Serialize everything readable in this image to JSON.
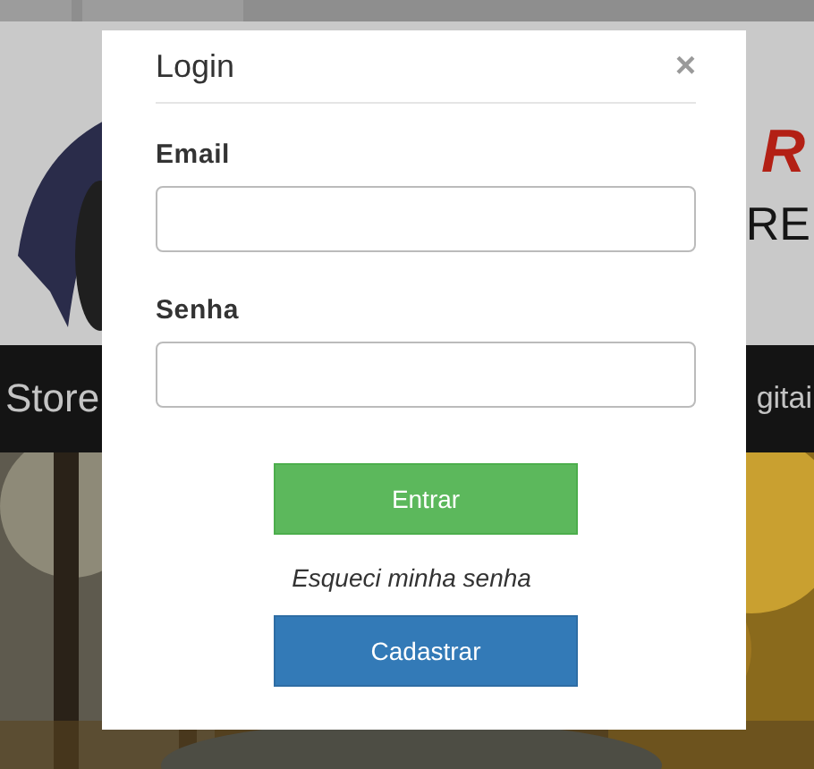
{
  "page": {
    "logo_text_top": "R",
    "logo_text_bottom": "RE",
    "nav_left": "Store",
    "nav_right": "gitai"
  },
  "modal": {
    "title": "Login",
    "close": "×",
    "fields": [
      {
        "label": "Email"
      },
      {
        "label": "Senha"
      }
    ],
    "login_button": "Entrar",
    "forgot_link": "Esqueci minha senha",
    "register_button": "Cadastrar"
  }
}
